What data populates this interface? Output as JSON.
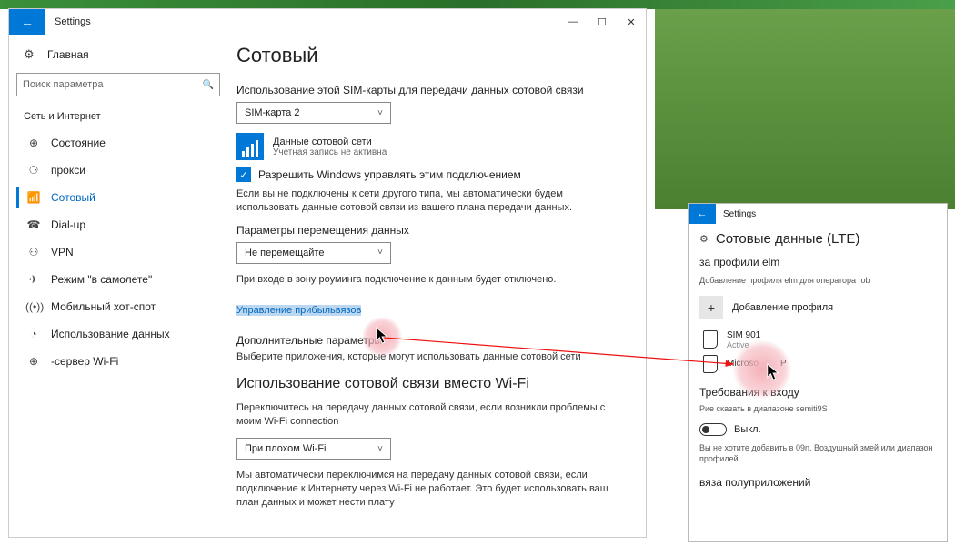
{
  "win1": {
    "title": "Settings",
    "back_glyph": "←",
    "min": "—",
    "max": "☐",
    "close": "✕",
    "home_icon": "⚙",
    "home_label": "Главная",
    "search_placeholder": "Поиск параметра",
    "search_icon": "🔍",
    "category": "Сеть и Интернет",
    "nav": [
      {
        "icon": "⊕",
        "label": "Состояние"
      },
      {
        "icon": "⚆",
        "label": "прокси"
      },
      {
        "icon": "📶",
        "label": "Сотовый",
        "sel": true
      },
      {
        "icon": "☎",
        "label": "Dial-up"
      },
      {
        "icon": "⚇",
        "label": "VPN"
      },
      {
        "icon": "✈",
        "label": "Режим \"в самолете\""
      },
      {
        "icon": "((•))",
        "label": "Мобильный хот-спот"
      },
      {
        "icon": "◔",
        "label": "Использование данных"
      },
      {
        "icon": "⊕",
        "label": "-сервер Wi-Fi"
      }
    ]
  },
  "content": {
    "h1": "Сотовый",
    "use_sim_label": "Использование этой SIM-карты для передачи данных сотовой связи",
    "sim_select": "SIM-карта 2",
    "data_line1": "Данные сотовой сети",
    "data_line2": "Учетная запись не активна",
    "allow_win": "Разрешить Windows управлять этим подключением",
    "auto_para": "Если вы не подключены к сети другого типа, мы автоматически будем использовать данные сотовой связи из вашего плана передачи данных.",
    "roam_label": "Параметры перемещения данных",
    "roam_select": "Не перемещайте",
    "roam_para": "При входе в зону роуминга подключение к данным будет отключено.",
    "manage_link": "Управление прибыльвязов",
    "extra_header": "Дополнительные параметры",
    "extra_para": "Выберите приложения, которые могут использовать данные сотовой сети",
    "h2": "Использование сотовой связи вместо Wi-Fi",
    "switch_para": "Переключитесь на передачу данных сотовой связи, если возникли проблемы с моим Wi-Fi connection",
    "wifi_select": "При плохом Wi-Fi",
    "bottom_para": "Мы автоматически переключимся на передачу данных сотовой связи, если подключение к Интернету через Wi-Fi не работает. Это будет использовать ваш план данных и может нести плату"
  },
  "win2": {
    "title": "Settings",
    "back": "←",
    "gear": "⚙",
    "h3": "Сотовые данные (LTE)",
    "profiles_header": "за профили elm",
    "add_hint": "Добавление профиля elm для оператора rob",
    "add_label": "Добавление профиля",
    "plus": "+",
    "sim1_name": "SIM 901",
    "sim1_status": "Active",
    "sim2_name": "Microso",
    "sim2_suffix": "P",
    "signin_h": "Требования к входу",
    "signin_small": "Pие сказать в диапазоне semiti9S",
    "toggle_label": "Выкл.",
    "hint2": "Вы не хотите добавить в 09n. Воздушный змей или диапазон профилей",
    "footer": "вяза полуприложений"
  }
}
